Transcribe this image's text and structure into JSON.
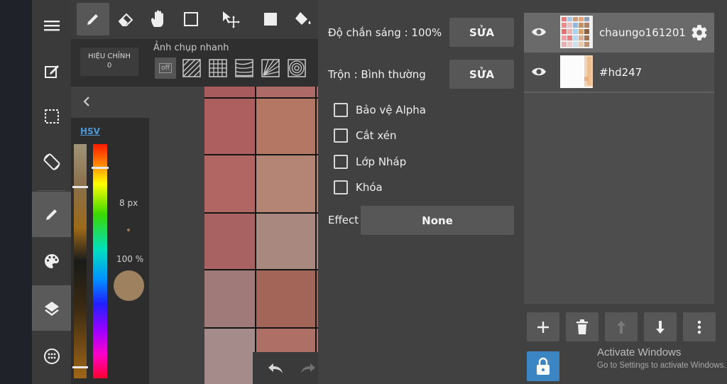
{
  "toolbar": {
    "tools": [
      "pen-icon",
      "eraser-icon",
      "hand-icon",
      "rectangle-select-icon",
      "move-icon",
      "fill-square-icon",
      "bucket-icon"
    ],
    "active_tool": "pen-icon"
  },
  "subbar": {
    "hieu_chinh_line1": "HIỆU CHỈNH",
    "hieu_chinh_line2": "0",
    "snap_label": "Ảnh chụp nhanh",
    "snap_off": "off"
  },
  "leftnav": {
    "items": [
      "menu-icon",
      "edit-icon",
      "selection-icon",
      "rotate-icon",
      "pen-icon",
      "palette-icon",
      "layers-icon",
      "more-icon"
    ],
    "active": [
      "pen-icon",
      "layers-icon"
    ]
  },
  "colorpanel": {
    "mode_label": "HSV",
    "brush_size": "8 px",
    "opacity": "100 %",
    "current_color": "#9e8260",
    "hue_level": 0.05,
    "value_level": 0.4
  },
  "props": {
    "opacity_label": "Độ chắn sáng : 100%",
    "opacity_button": "SỬA",
    "blend_label": "Trộn : Bình thường",
    "blend_button": "SỬA",
    "checkboxes": [
      "Bảo vệ Alpha",
      "Cắt xén",
      "Lớp Nháp",
      "Khóa"
    ],
    "effect_label": "Effect",
    "effect_value": "None"
  },
  "layers": {
    "items": [
      {
        "name": "chaungo161201",
        "visible": true,
        "selected": true
      },
      {
        "name": "#hd247",
        "visible": true,
        "selected": false
      }
    ]
  },
  "watermark": {
    "title": "Activate Windows",
    "subtitle": "Go to Settings to activate Windows."
  },
  "colors": {
    "accent": "#3b86c2",
    "hsv_link": "#4a9ad8"
  }
}
